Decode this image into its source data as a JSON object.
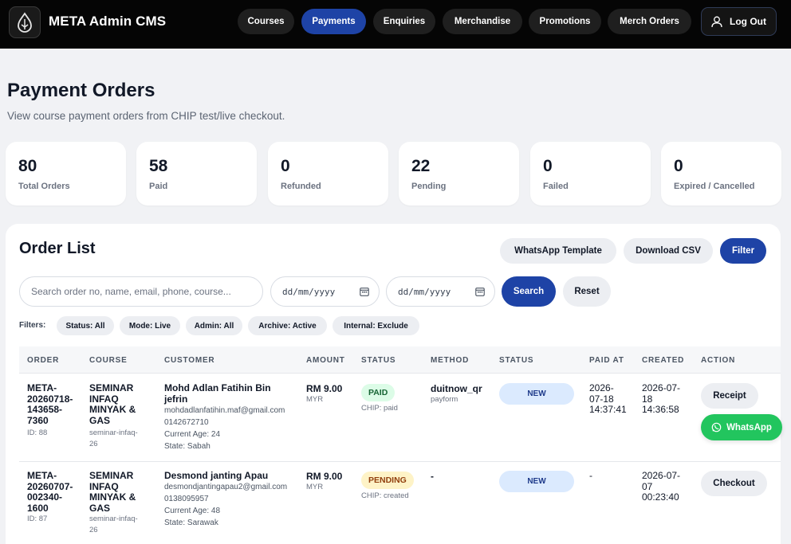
{
  "app": {
    "title": "META Admin CMS"
  },
  "nav": [
    {
      "label": "Courses",
      "active": false
    },
    {
      "label": "Payments",
      "active": true
    },
    {
      "label": "Enquiries",
      "active": false
    },
    {
      "label": "Merchandise",
      "active": false
    },
    {
      "label": "Promotions",
      "active": false
    },
    {
      "label": "Merch Orders",
      "active": false
    }
  ],
  "logout": {
    "label": "Log Out",
    "icon": "user-icon"
  },
  "page": {
    "title": "Payment Orders",
    "subtitle": "View course payment orders from CHIP test/live checkout."
  },
  "stats": [
    {
      "value": "80",
      "label": "Total Orders"
    },
    {
      "value": "58",
      "label": "Paid"
    },
    {
      "value": "0",
      "label": "Refunded"
    },
    {
      "value": "22",
      "label": "Pending"
    },
    {
      "value": "0",
      "label": "Failed"
    },
    {
      "value": "0",
      "label": "Expired / Cancelled"
    }
  ],
  "order_list": {
    "title": "Order List",
    "buttons": {
      "whatsapp_template": "WhatsApp Template",
      "download_csv": "Download CSV",
      "filter": "Filter"
    },
    "search": {
      "placeholder": "Search order no, name, email, phone, course...",
      "value": ""
    },
    "date_from": {
      "value": "dd/mm/yyyy"
    },
    "date_to": {
      "value": "dd/mm/yyyy"
    },
    "search_button": "Search",
    "reset_button": "Reset",
    "filters_label": "Filters:",
    "filters": [
      "Status: All",
      "Mode: Live",
      "Admin: All",
      "Archive: Active",
      "Internal: Exclude"
    ],
    "columns": [
      "ORDER",
      "COURSE",
      "CUSTOMER",
      "AMOUNT",
      "STATUS",
      "METHOD",
      "STATUS",
      "PAID AT",
      "CREATED",
      "ACTION"
    ],
    "rows": [
      {
        "order_no": "META-\n20260718-\n143658-\n7360",
        "id": "ID: 88",
        "course": "SEMINAR\nINFAQ\nMINYAK &\nGAS",
        "course_slug": "seminar-infaq-\n26",
        "customer_name": "Mohd Adlan Fatihin Bin\njefrin",
        "email": "mohdadlanfatihin.maf@gmail.com",
        "phone": "0142672710",
        "age": "Current Age: 24",
        "state": "State: Sabah",
        "amount": "RM 9.00",
        "currency": "MYR",
        "payment_status": "PAID",
        "payment_status_type": "paid",
        "chip_status": "CHIP: paid",
        "method": "duitnow_qr",
        "method_sub": "payform",
        "order_status": "NEW",
        "paid_at": "2026-\n07-18\n14:37:41",
        "created": "2026-07-\n18\n14:36:58",
        "actions": [
          "Receipt",
          "WhatsApp"
        ]
      },
      {
        "order_no": "META-\n20260707-\n002340-\n1600",
        "id": "ID: 87",
        "course": "SEMINAR\nINFAQ\nMINYAK &\nGAS",
        "course_slug": "seminar-infaq-\n26",
        "customer_name": "Desmond janting Apau",
        "email": "desmondjantingapau2@gmail.com",
        "phone": "0138095957",
        "age": "Current Age: 48",
        "state": "State: Sarawak",
        "amount": "RM 9.00",
        "currency": "MYR",
        "payment_status": "PENDING",
        "payment_status_type": "pending",
        "chip_status": "CHIP: created",
        "method": "-",
        "method_sub": "",
        "order_status": "NEW",
        "paid_at": "-",
        "created": "2026-07-\n07\n00:23:40",
        "actions": [
          "Checkout"
        ]
      }
    ]
  },
  "colors": {
    "topbar": "#050505",
    "accent": "#1e43a6",
    "whatsapp": "#22c55e",
    "page_bg": "#f1f2f5"
  }
}
